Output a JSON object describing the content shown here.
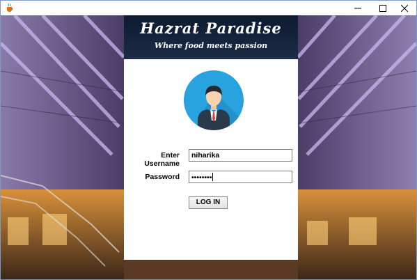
{
  "window": {
    "controls": {
      "minimize": "minimize",
      "maximize": "maximize",
      "close": "close"
    }
  },
  "brand": {
    "title": "Hazrat Paradise",
    "tagline": "Where food meets passion"
  },
  "login": {
    "username_label": "Enter Username",
    "username_value": "niharika",
    "password_label": "Password",
    "password_value": "••••••••",
    "button_label": "LOG IN"
  },
  "icons": {
    "app": "java-cup-icon",
    "avatar": "user-avatar-icon"
  },
  "colors": {
    "avatar_bg": "#29a3e0",
    "banner_bg": "#15253d"
  }
}
